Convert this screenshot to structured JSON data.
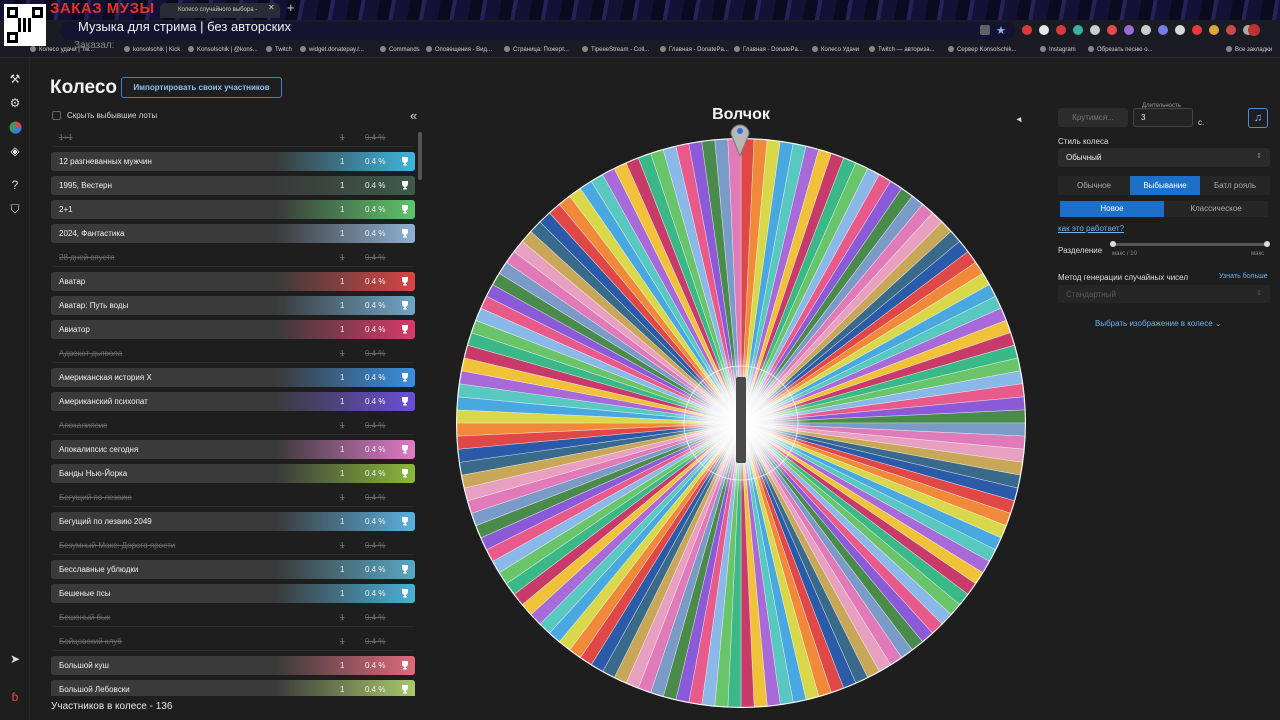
{
  "browser": {
    "overlay_order_text": "ЗАКАЗ МУЗЫ",
    "tab_title": "Колесо случайного выбора -",
    "url_overlay_text": "Музыка для стрима | без авторских",
    "ordered_text": "Заказал:",
    "bookmarks": [
      "Колесо удачи | Tw...",
      "konsolschik | Kick",
      "Konsolschik | @kons...",
      "Twitch",
      "widget.donatepay.r...",
      "Commands",
      "Оповещения - Вид...",
      "Страница: Пожерт...",
      "TipeeeStream - Coll...",
      "Главная - DonatePa...",
      "Главная - DonatePa...",
      "Колесо Удачи",
      "Twitch — авториза...",
      "Сервер Konsolschik...",
      "Instagram",
      "Обрезать песню о...",
      "Все закладки"
    ]
  },
  "header": {
    "title": "Колесо",
    "import_button": "Импортировать своих участников"
  },
  "filter": {
    "hide_label": "Скрыть выбывшие лоты"
  },
  "lots": [
    {
      "name": "1+1",
      "amount": "1",
      "percent": "0.4 %",
      "eliminated": true,
      "color": "#888888"
    },
    {
      "name": "12 разгневанных мужчин",
      "amount": "1",
      "percent": "0.4 %",
      "eliminated": false,
      "color": "#3fb6e0"
    },
    {
      "name": "1995, Вестерн",
      "amount": "1",
      "percent": "0.4 %",
      "eliminated": false,
      "color": "#3d5a4c"
    },
    {
      "name": "2+1",
      "amount": "1",
      "percent": "0.4 %",
      "eliminated": false,
      "color": "#5cc56a"
    },
    {
      "name": "2024, Фантастика",
      "amount": "1",
      "percent": "0.4 %",
      "eliminated": false,
      "color": "#8fb1d4"
    },
    {
      "name": "28 дней спустя",
      "amount": "1",
      "percent": "0.4 %",
      "eliminated": true,
      "color": "#888888"
    },
    {
      "name": "Аватар",
      "amount": "1",
      "percent": "0.4 %",
      "eliminated": false,
      "color": "#d84545"
    },
    {
      "name": "Аватар: Путь воды",
      "amount": "1",
      "percent": "0.4 %",
      "eliminated": false,
      "color": "#6fa6c8"
    },
    {
      "name": "Авиатор",
      "amount": "1",
      "percent": "0.4 %",
      "eliminated": false,
      "color": "#d83a6a"
    },
    {
      "name": "Адвокат дьявола",
      "amount": "1",
      "percent": "0.4 %",
      "eliminated": true,
      "color": "#888888"
    },
    {
      "name": "Американская история Х",
      "amount": "1",
      "percent": "0.4 %",
      "eliminated": false,
      "color": "#3a8fe0"
    },
    {
      "name": "Американский психопат",
      "amount": "1",
      "percent": "0.4 %",
      "eliminated": false,
      "color": "#6a4fd8"
    },
    {
      "name": "Апокалипсис",
      "amount": "1",
      "percent": "0.4 %",
      "eliminated": true,
      "color": "#888888"
    },
    {
      "name": "Апокалипсис сегодня",
      "amount": "1",
      "percent": "0.4 %",
      "eliminated": false,
      "color": "#e07ac8"
    },
    {
      "name": "Банды Нью-Йорка",
      "amount": "1",
      "percent": "0.4 %",
      "eliminated": false,
      "color": "#8bb83a"
    },
    {
      "name": "Бегущий по лезвию",
      "amount": "1",
      "percent": "0.4 %",
      "eliminated": true,
      "color": "#888888"
    },
    {
      "name": "Бегущий по лезвию 2049",
      "amount": "1",
      "percent": "0.4 %",
      "eliminated": false,
      "color": "#5ab0e0"
    },
    {
      "name": "Безумный Макс: Дорога ярости",
      "amount": "1",
      "percent": "0.4 %",
      "eliminated": true,
      "color": "#888888"
    },
    {
      "name": "Бесславные ублюдки",
      "amount": "1",
      "percent": "0.4 %",
      "eliminated": false,
      "color": "#58a8c4"
    },
    {
      "name": "Бешеные псы",
      "amount": "1",
      "percent": "0.4 %",
      "eliminated": false,
      "color": "#4bb0d8"
    },
    {
      "name": "Бешеный бык",
      "amount": "1",
      "percent": "0.4 %",
      "eliminated": true,
      "color": "#888888"
    },
    {
      "name": "Бойцовский клуб",
      "amount": "1",
      "percent": "0.4 %",
      "eliminated": true,
      "color": "#888888"
    },
    {
      "name": "Большой куш",
      "amount": "1",
      "percent": "0.4 %",
      "eliminated": false,
      "color": "#e06a7a"
    },
    {
      "name": "Большой Лебовски",
      "amount": "1",
      "percent": "0.4 %",
      "eliminated": false,
      "color": "#a8c86a"
    }
  ],
  "footer": {
    "participants": "Участников в колесе - 136"
  },
  "wheel": {
    "title": "Волчок",
    "segment_colors": [
      "#e04848",
      "#4aa8e0",
      "#f0c23a",
      "#6ac46a",
      "#8a5ad8",
      "#e07ab8",
      "#3a6a8a",
      "#f08a3a",
      "#58c8c0",
      "#c83a6a",
      "#8ab8e8",
      "#4a8a4a",
      "#e8a0c0",
      "#2a5aa8",
      "#d8d84a",
      "#a86ad8",
      "#3ab888",
      "#e85a8a",
      "#7a9ac8",
      "#c8a858"
    ]
  },
  "settings": {
    "spin_button": "Крутимся...",
    "duration_label": "Длительность",
    "duration_value": "3",
    "duration_unit": "с.",
    "wheel_style_label": "Стиль колеса",
    "wheel_style_value": "Обычный",
    "modes": [
      "Обычное",
      "Выбывание",
      "Батл рояль"
    ],
    "active_mode": "Выбывание",
    "variants": [
      "Новое",
      "Классическое"
    ],
    "active_variant": "Новое",
    "how_it_works": "как это работает?",
    "split_label": "Разделение",
    "split_min": "макс / 10",
    "split_max": "макс",
    "rng_label": "Метод генерации случайных чисел",
    "rng_more": "Узнать больше",
    "rng_value": "Стандартный",
    "image_link": "Выбрать изображение в колесе"
  }
}
